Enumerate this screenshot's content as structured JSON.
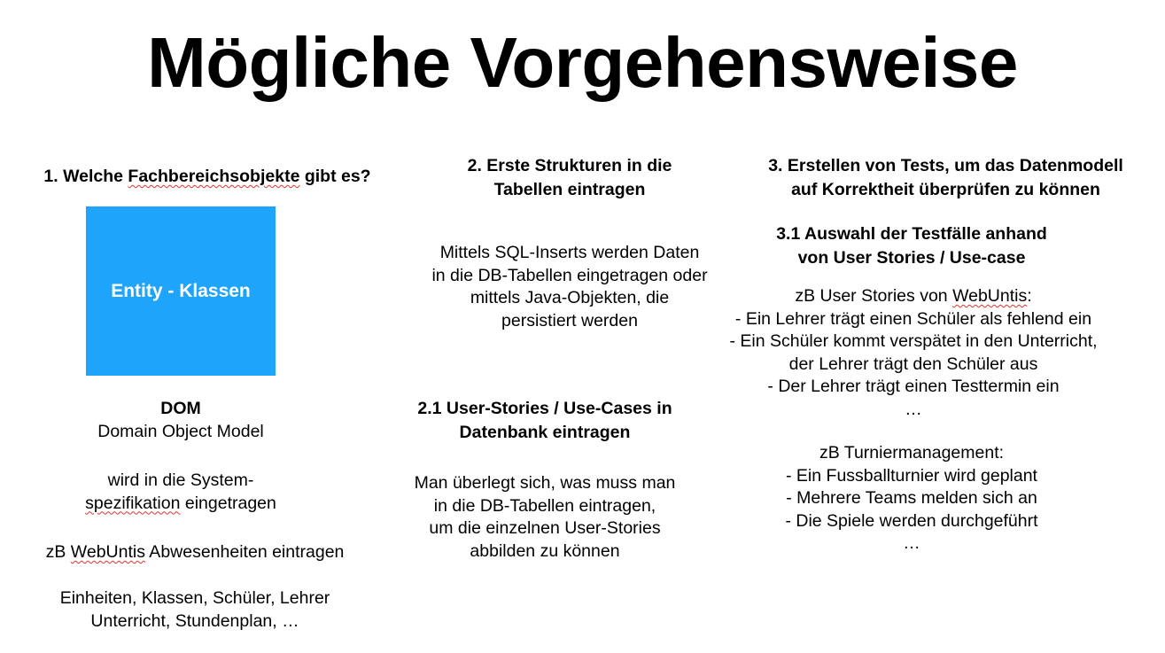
{
  "slide": {
    "title": "Mögliche Vorgehensweise",
    "colors": {
      "box": "#1ea4fb",
      "box_text": "#ffffff",
      "spell_underline": "#e0342b"
    }
  },
  "col1": {
    "heading_pre": "1. Welche ",
    "heading_word": "Fachbereichsobjekte",
    "heading_post": " gibt es?",
    "box_label": "Entity - Klassen",
    "dom_title": "DOM",
    "dom_subtitle": "Domain Object Model",
    "spec_line1": "wird in die System-",
    "spec_line2_word": "spezifikation",
    "spec_line2_post": " eingetragen",
    "example_pre": "zB ",
    "example_word": "WebUntis",
    "example_post": " Abwesenheiten eintragen",
    "units_line1": "Einheiten, Klassen, Schüler, Lehrer",
    "units_line2": "Unterricht, Stundenplan, …"
  },
  "col2": {
    "heading_line1": "2. Erste Strukturen in die",
    "heading_line2": "Tabellen eintragen",
    "para_lines": [
      "Mittels SQL-Inserts werden Daten",
      "in die DB-Tabellen eingetragen oder",
      "mittels Java-Objekten, die",
      "persistiert werden"
    ],
    "sub_heading_line1": "2.1 User-Stories / Use-Cases in",
    "sub_heading_line2": "Datenbank eintragen",
    "sub_para_lines": [
      "Man überlegt sich, was muss man",
      "in die DB-Tabellen eintragen,",
      "um die einzelnen User-Stories",
      "abbilden zu können"
    ]
  },
  "col3": {
    "heading_line1": "3. Erstellen von Tests, um das Datenmodell",
    "heading_line2": "auf Korrektheit überprüfen zu können",
    "sub_heading_line1": "3.1 Auswahl der Testfälle anhand",
    "sub_heading_line2": "von User Stories / Use-case",
    "webuntis_intro_pre": "zB User Stories von ",
    "webuntis_intro_word": "WebUntis",
    "webuntis_intro_post": ":",
    "webuntis_items": [
      "- Ein Lehrer trägt einen Schüler als fehlend ein",
      "- Ein Schüler kommt verspätet in den Unterricht,",
      "der Lehrer trägt den Schüler aus",
      "- Der Lehrer trägt einen Testtermin ein",
      "…"
    ],
    "turnier_intro": "zB Turniermanagement:",
    "turnier_items": [
      "- Ein Fussballturnier wird geplant",
      "- Mehrere Teams melden sich an",
      "-  Die Spiele werden durchgeführt",
      "…"
    ]
  }
}
